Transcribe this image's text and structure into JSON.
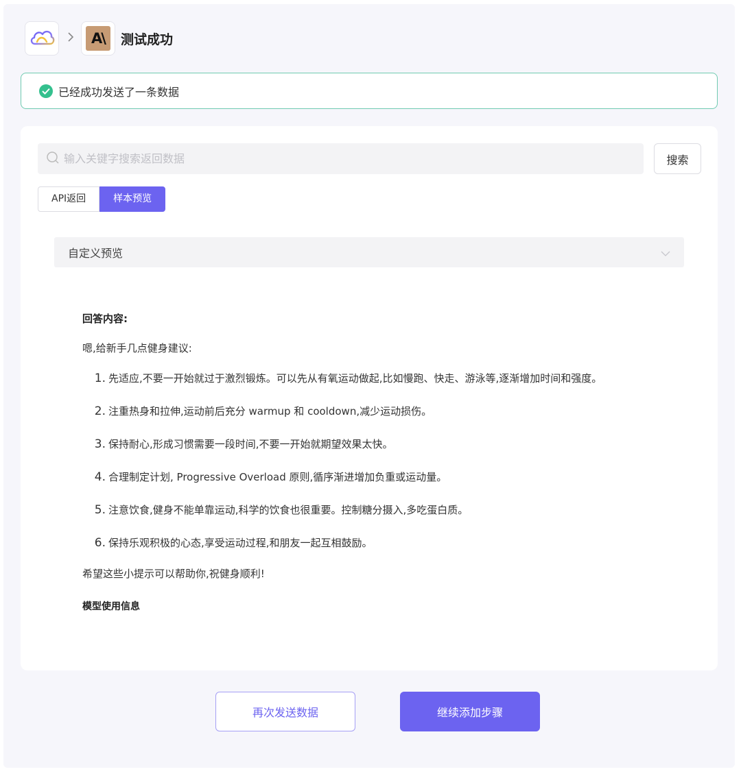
{
  "header": {
    "app_icon": "cloud-icon",
    "separator_icon": "chevron-right-icon",
    "integration_logo_text": "A\\",
    "step_title": "测试成功"
  },
  "alert": {
    "icon": "check-circle-icon",
    "message": "已经成功发送了一条数据"
  },
  "search": {
    "placeholder": "输入关键字搜索返回数据",
    "value": "",
    "button_label": "搜索"
  },
  "tabs": [
    {
      "label": "API返回",
      "active": false
    },
    {
      "label": "样本预览",
      "active": true
    }
  ],
  "preview_select": {
    "selected": "自定义预览",
    "icon": "chevron-down-icon"
  },
  "preview": {
    "answer_label": "回答内容:",
    "intro": "嗯,给新手几点健身建议:",
    "items": [
      {
        "num": "1.",
        "text": "先适应,不要一开始就过于激烈锻炼。可以先从有氧运动做起,比如慢跑、快走、游泳等,逐渐增加时间和强度。"
      },
      {
        "num": "2.",
        "text": "注重热身和拉伸,运动前后充分 warmup 和 cooldown,减少运动损伤。"
      },
      {
        "num": "3.",
        "text": "保持耐心,形成习惯需要一段时间,不要一开始就期望效果太快。"
      },
      {
        "num": "4.",
        "text": "合理制定计划, Progressive Overload 原则,循序渐进增加负重或运动量。"
      },
      {
        "num": "5.",
        "text": "注意饮食,健身不能单靠运动,科学的饮食也很重要。控制糖分摄入,多吃蛋白质。"
      },
      {
        "num": "6.",
        "text": "保持乐观积极的心态,享受运动过程,和朋友一起互相鼓励。"
      }
    ],
    "outro": "希望这些小提示可以帮助你,祝健身顺利!",
    "usage_label": "模型使用信息"
  },
  "actions": {
    "resend_label": "再次发送数据",
    "continue_label": "继续添加步骤"
  },
  "colors": {
    "accent": "#6c63f0",
    "success": "#34c08e",
    "success_border": "#6fcab0"
  }
}
